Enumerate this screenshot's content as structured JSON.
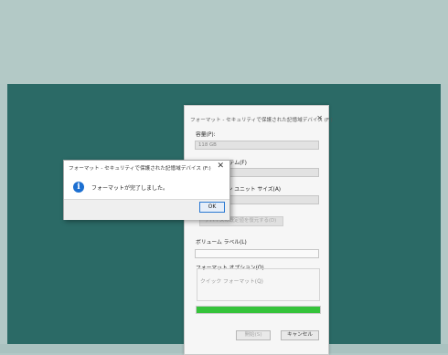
{
  "format_dialog": {
    "title": "フォーマット - セキュリティで保護された記憶域デバイス (F:)",
    "capacity_label": "容量(P):",
    "capacity_value": "118 GB",
    "filesystem_label": "ファイル システム(F)",
    "filesystem_value": "",
    "alloc_label": "アロケーション ユニット サイズ(A)",
    "alloc_value": "",
    "restore_defaults_label": "デバイスの既定値を復元する(D)",
    "volume_label": "ボリューム ラベル(L)",
    "volume_value": "",
    "options_label": "フォーマット オプション(O)",
    "quick_format_label": "クイック フォーマット(Q)",
    "progress_percent": 100,
    "start_label": "開始(S)",
    "cancel_label": "キャンセル"
  },
  "message_box": {
    "title": "フォーマット - セキュリティで保護された記憶域デバイス (F:)",
    "close_glyph": "✕",
    "message": "フォーマットが完了しました。",
    "ok_label": "OK"
  },
  "colors": {
    "desktop": "#2b6a66",
    "progress_fill": "#35c33a",
    "info_icon": "#1c6fd1"
  }
}
